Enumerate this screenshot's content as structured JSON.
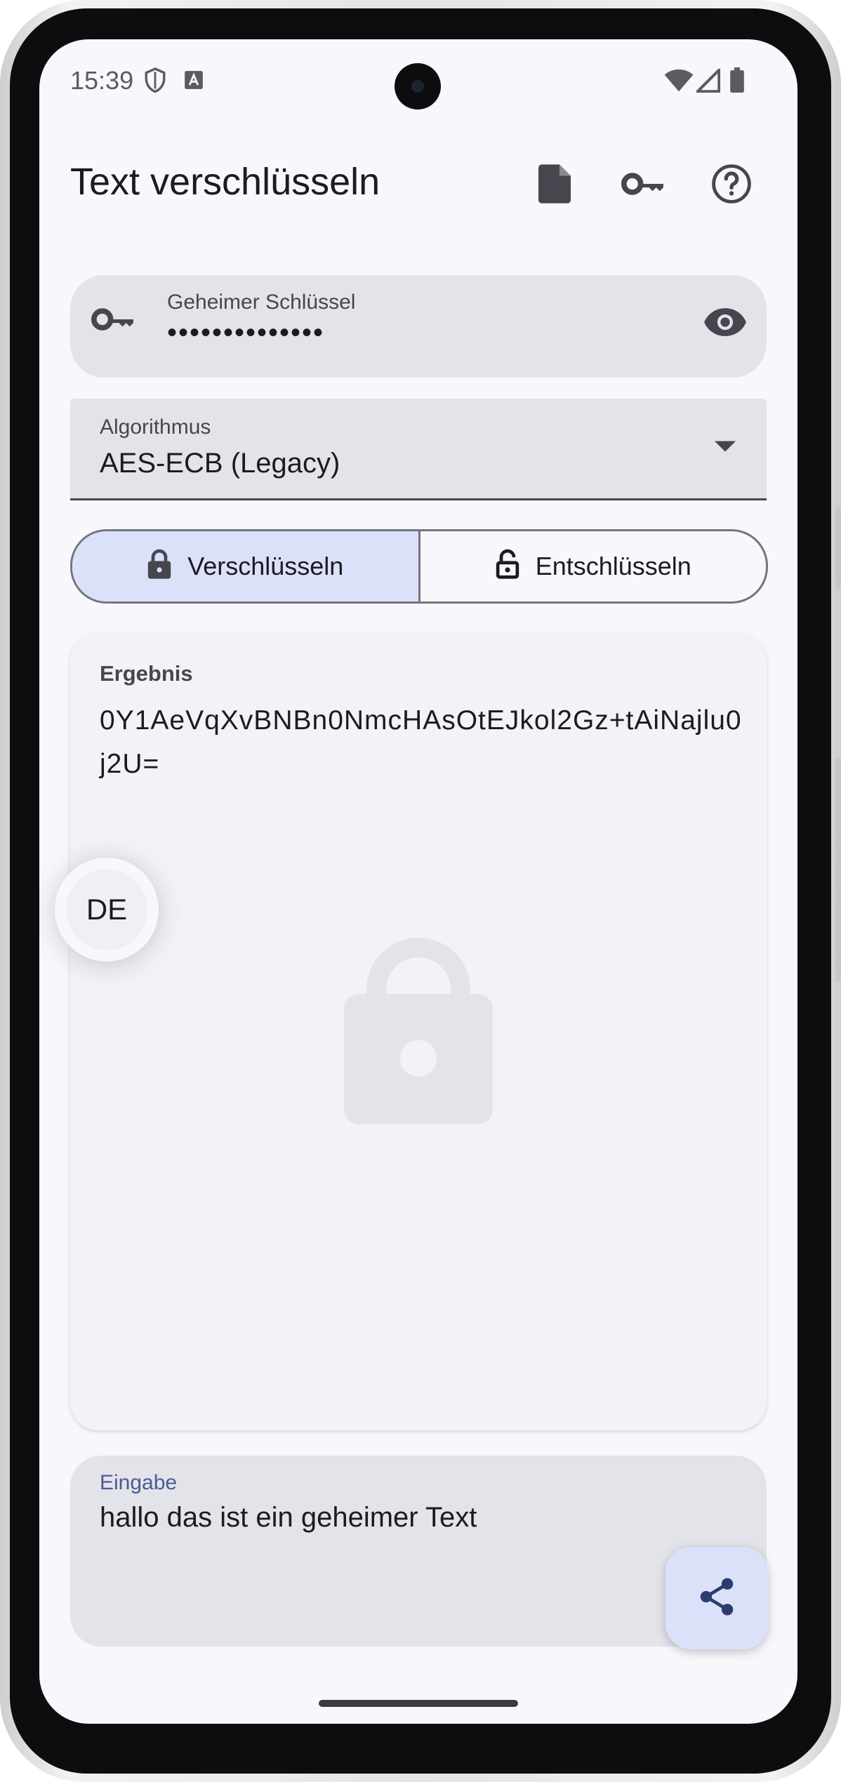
{
  "status_bar": {
    "time": "15:39"
  },
  "app_bar": {
    "title": "Text verschlüsseln",
    "actions": [
      {
        "icon": "file-icon"
      },
      {
        "icon": "key-icon"
      },
      {
        "icon": "help-icon"
      }
    ]
  },
  "key_field": {
    "label": "Geheimer Schlüssel",
    "value": "••••••••••••••",
    "leading_icon": "key-icon",
    "trailing_icon": "eye-icon"
  },
  "algorithm": {
    "label": "Algorithmus",
    "value": "AES-ECB (Legacy)"
  },
  "mode": {
    "encrypt_label": "Verschlüsseln",
    "decrypt_label": "Entschlüsseln",
    "selected": "encrypt"
  },
  "result": {
    "label": "Ergebnis",
    "value": "0Y1AeVqXvBNBn0NmcHAsOtEJkol2Gz+tAiNajlu0j2U="
  },
  "language_bubble": {
    "code": "DE"
  },
  "input": {
    "label": "Eingabe",
    "value": "hallo das ist ein geheimer Text"
  },
  "colors": {
    "background": "#f7f7fc",
    "surface_variant": "#e3e3ea",
    "secondary_container": "#dbe1f9",
    "primary_label": "#4b5c92",
    "on_surface": "#1c1b1f"
  }
}
